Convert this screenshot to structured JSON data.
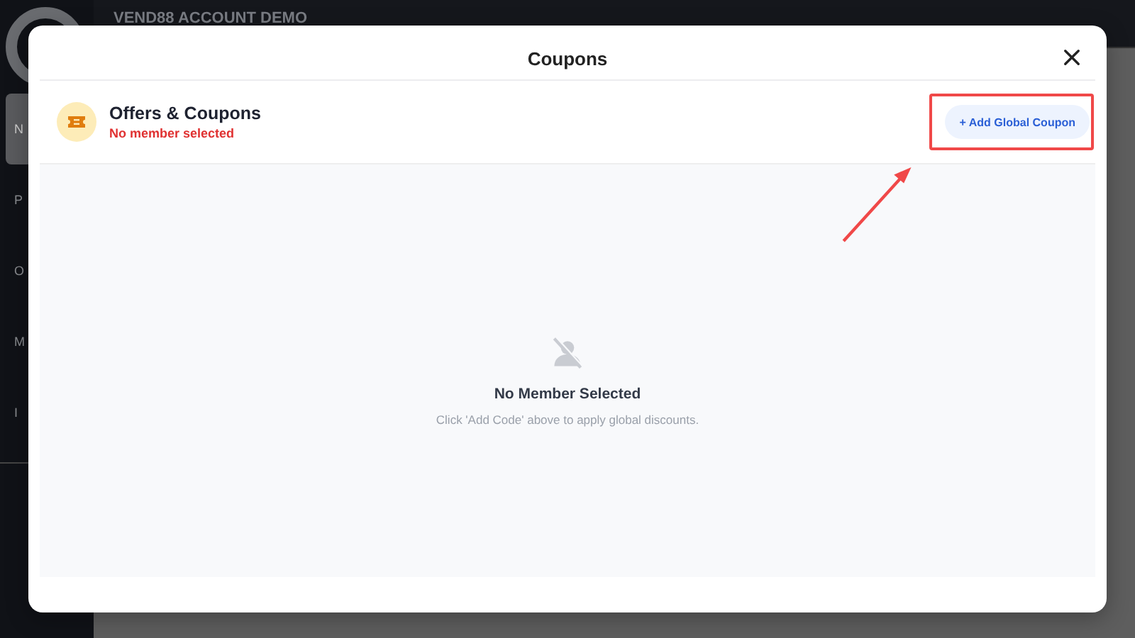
{
  "app": {
    "header_title": "VEND88 ACCOUNT DEMO",
    "sidebar": [
      {
        "label": "N",
        "selected": true
      },
      {
        "label": "P",
        "selected": false
      },
      {
        "label": "O",
        "selected": false
      },
      {
        "label": "M",
        "selected": false
      },
      {
        "label": "I",
        "selected": false
      }
    ]
  },
  "dialog": {
    "title": "Coupons",
    "section": {
      "title": "Offers & Coupons",
      "status": "No member selected"
    },
    "action_button": "+ Add Global Coupon",
    "empty_state": {
      "title": "No Member Selected",
      "message": "Click 'Add Code' above to apply global discounts."
    }
  }
}
